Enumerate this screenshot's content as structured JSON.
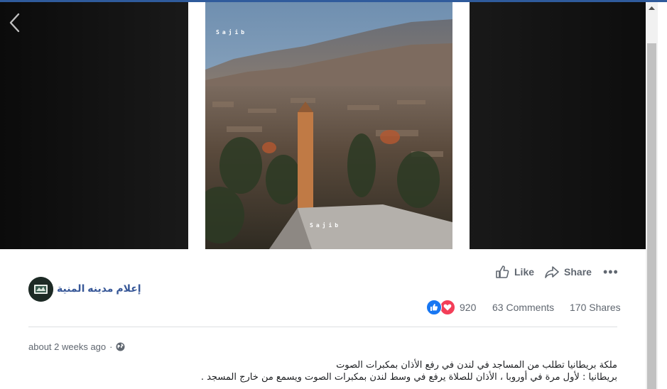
{
  "media": {
    "watermark_top": "Sajib",
    "watermark_bottom": "Sajib"
  },
  "actions": {
    "like_label": "Like",
    "share_label": "Share",
    "more_label": "•••"
  },
  "page": {
    "name": "إعلام مدينه المنية"
  },
  "stats": {
    "reactions_count": "920",
    "comments": "63 Comments",
    "shares": "170 Shares"
  },
  "post": {
    "timestamp": "about 2 weeks ago",
    "separator": "·",
    "privacy_icon": "globe-icon",
    "text_lines": [
      "ملكة بريطانيا تطلب من المساجد في لندن في رفع الأذان بمكبرات الصوت",
      "بريطانيا : لأول مرة في أوروبا ، الأذان للصلاة يرفع في وسط لندن بمكبرات الصوت ويسمع من خارج المسجد ."
    ]
  },
  "colors": {
    "link_blue": "#385898",
    "like_blue": "#1877f2",
    "love_red": "#f33e58",
    "muted_text": "#606770"
  }
}
